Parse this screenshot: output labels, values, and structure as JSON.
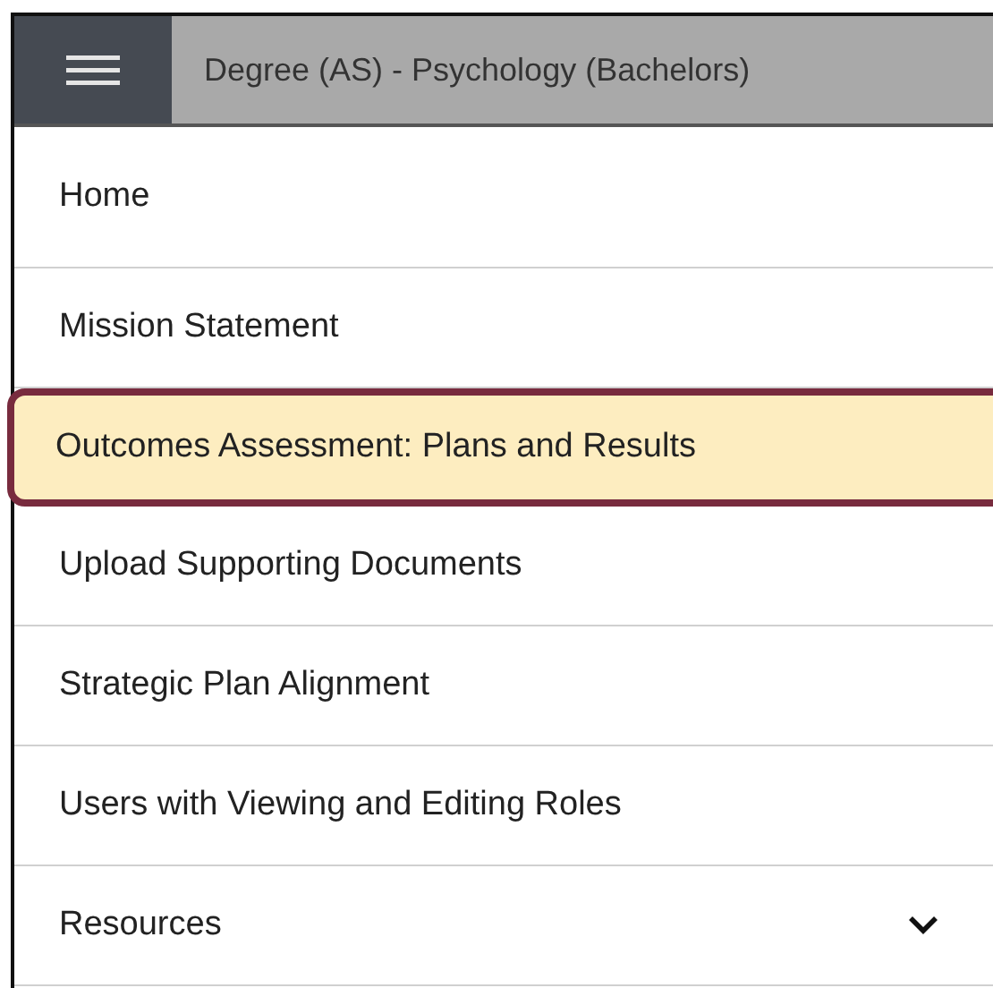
{
  "header": {
    "title": "Degree (AS) - Psychology (Bachelors)"
  },
  "nav_items": [
    {
      "label": "Home",
      "selected": false
    },
    {
      "label": "Mission Statement",
      "selected": false
    },
    {
      "label": "Outcomes Assessment: Plans and Results",
      "selected": true
    },
    {
      "label": "Upload Supporting Documents",
      "selected": false
    },
    {
      "label": "Strategic Plan Alignment",
      "selected": false
    },
    {
      "label": "Users with Viewing and Editing Roles",
      "selected": false
    },
    {
      "label": "Resources",
      "selected": false,
      "expanded": false
    }
  ]
}
